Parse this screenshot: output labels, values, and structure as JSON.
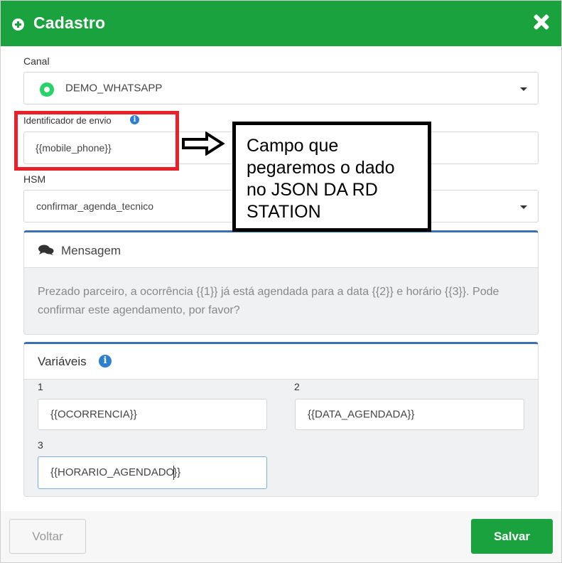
{
  "modal": {
    "title": "Cadastro",
    "close_icon": "close-x-icon",
    "header_icon": "plus-circle-icon",
    "colors": {
      "header": "#19a23d",
      "accent": "#3a6fb5",
      "annotation_red": "#e8202a"
    }
  },
  "form": {
    "canal": {
      "label": "Canal",
      "value": "DEMO_WHATSAPP",
      "icon": "whatsapp-icon"
    },
    "identificador": {
      "label": "Identificador de envio",
      "value": "{{mobile_phone}}",
      "info_icon": "info-icon"
    },
    "hsm": {
      "label": "HSM",
      "value": "confirmar_agenda_tecnico"
    }
  },
  "mensagem": {
    "title": "Mensagem",
    "icon": "comments-icon",
    "text": "Prezado parceiro, a ocorrência {{1}} já está agendada para a data {{2}} e horário {{3}}. Pode confirmar este agendamento, por favor?"
  },
  "variaveis": {
    "title": "Variáveis",
    "info_icon": "info-icon",
    "items": [
      {
        "label": "1",
        "value": "{{OCORRENCIA}}"
      },
      {
        "label": "2",
        "value": "{{DATA_AGENDADA}}"
      },
      {
        "label": "3",
        "value_before_cursor": "{{HORARIO_AGENDADO",
        "value_after_cursor": "}}"
      }
    ]
  },
  "annotation": {
    "note_lines": [
      "Campo que",
      "pegaremos o dado",
      "no JSON DA RD",
      "STATION"
    ],
    "arrow_icon": "hollow-right-arrow-icon"
  },
  "footer": {
    "back_label": "Voltar",
    "save_label": "Salvar"
  }
}
